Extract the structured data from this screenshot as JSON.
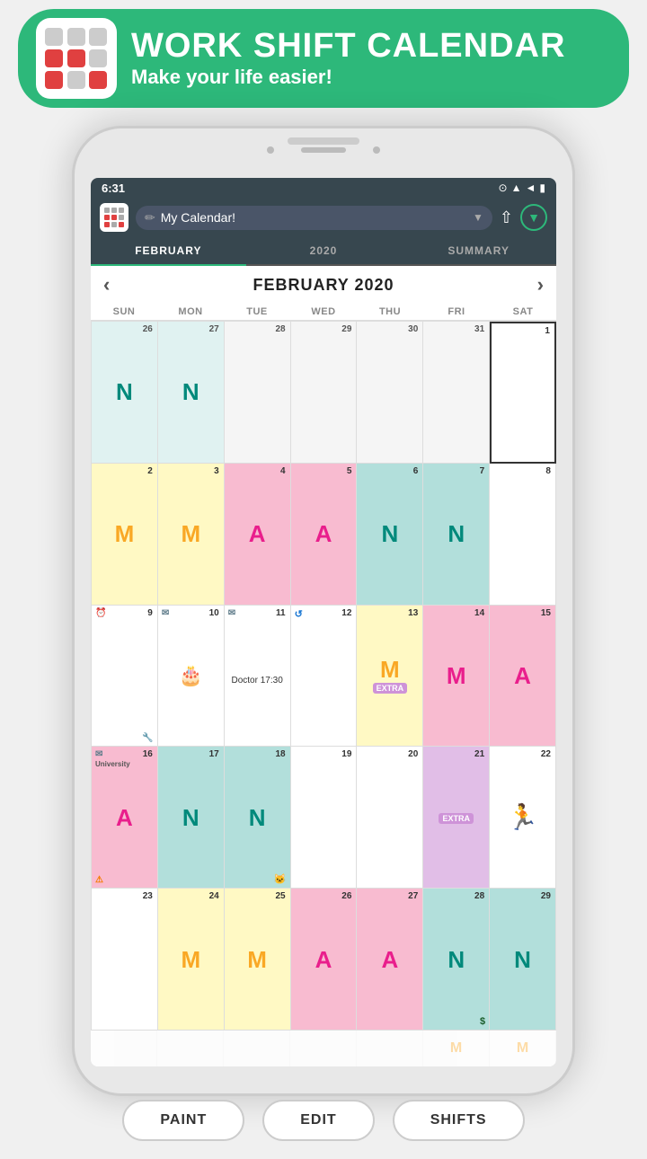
{
  "banner": {
    "title": "WORK SHIFT CALENDAR",
    "subtitle": "Make your life easier!"
  },
  "app": {
    "calendar_name": "My Calendar!",
    "tabs": [
      "FEBRUARY",
      "2020",
      "SUMMARY"
    ],
    "active_tab": 0
  },
  "calendar": {
    "month_title": "FEBRUARY 2020",
    "day_headers": [
      "SUN",
      "MON",
      "TUE",
      "WED",
      "THU",
      "FRI",
      "SAT"
    ],
    "nav_prev": "‹",
    "nav_next": "›"
  },
  "status_bar": {
    "time": "6:31",
    "icons": "▲◄■"
  },
  "bottom_buttons": {
    "paint": "PAINT",
    "edit": "EDIT",
    "shifts": "SHIFTS"
  },
  "cells": [
    {
      "day": "26",
      "shift": "N",
      "bg": "bg-light-teal",
      "letter_color": "letter-teal",
      "prev_month": true
    },
    {
      "day": "27",
      "shift": "N",
      "bg": "bg-light-teal",
      "letter_color": "letter-teal",
      "prev_month": true
    },
    {
      "day": "28",
      "shift": "",
      "bg": "bg-gray",
      "letter_color": "",
      "prev_month": true
    },
    {
      "day": "29",
      "shift": "",
      "bg": "bg-gray",
      "letter_color": "",
      "prev_month": true
    },
    {
      "day": "30",
      "shift": "",
      "bg": "bg-gray",
      "letter_color": "",
      "prev_month": true
    },
    {
      "day": "31",
      "shift": "",
      "bg": "bg-gray",
      "letter_color": "",
      "prev_month": true
    },
    {
      "day": "1",
      "shift": "",
      "bg": "bg-white",
      "letter_color": "",
      "selected": true
    },
    {
      "day": "2",
      "shift": "M",
      "bg": "bg-yellow",
      "letter_color": "letter-yellow"
    },
    {
      "day": "3",
      "shift": "M",
      "bg": "bg-yellow",
      "letter_color": "letter-yellow"
    },
    {
      "day": "4",
      "shift": "A",
      "bg": "bg-pink",
      "letter_color": "letter-pink"
    },
    {
      "day": "5",
      "shift": "A",
      "bg": "bg-pink",
      "letter_color": "letter-pink",
      "day_color": "pink"
    },
    {
      "day": "6",
      "shift": "N",
      "bg": "bg-teal",
      "letter_color": "letter-teal",
      "day_color": "teal"
    },
    {
      "day": "7",
      "shift": "N",
      "bg": "bg-teal",
      "letter_color": "letter-teal",
      "day_color": "teal"
    },
    {
      "day": "8",
      "shift": "",
      "bg": "bg-white",
      "letter_color": ""
    },
    {
      "day": "9",
      "shift": "",
      "bg": "bg-white",
      "letter_color": "",
      "has_alarm": true
    },
    {
      "day": "10",
      "shift": "",
      "bg": "bg-white",
      "letter_color": "",
      "event": "🎂",
      "has_mail": true
    },
    {
      "day": "11",
      "shift": "",
      "bg": "bg-white",
      "letter_color": "",
      "event_text": "Doctor\n17:30",
      "has_mail": true
    },
    {
      "day": "12",
      "shift": "",
      "bg": "bg-white",
      "letter_color": ""
    },
    {
      "day": "13",
      "shift": "M",
      "bg": "bg-yellow",
      "letter_color": "letter-yellow",
      "extra": true
    },
    {
      "day": "14",
      "shift": "M",
      "bg": "bg-pink",
      "letter_color": "letter-pink"
    },
    {
      "day": "15",
      "shift": "A",
      "bg": "bg-pink",
      "letter_color": "letter-pink",
      "day_color": "pink"
    },
    {
      "day": "16",
      "shift": "A",
      "bg": "bg-pink",
      "letter_color": "letter-pink",
      "day_color": "pink",
      "note": "University",
      "has_mail": true,
      "has_warning": true
    },
    {
      "day": "17",
      "shift": "N",
      "bg": "bg-teal",
      "letter_color": "letter-teal",
      "day_color": "teal"
    },
    {
      "day": "18",
      "shift": "N",
      "bg": "bg-teal",
      "letter_color": "letter-teal",
      "day_color": "teal"
    },
    {
      "day": "19",
      "shift": "",
      "bg": "bg-white",
      "letter_color": ""
    },
    {
      "day": "20",
      "shift": "",
      "bg": "bg-white",
      "letter_color": ""
    },
    {
      "day": "21",
      "shift": "",
      "bg": "bg-purple",
      "letter_color": "",
      "extra": true
    },
    {
      "day": "22",
      "shift": "🏃",
      "bg": "bg-white",
      "letter_color": "",
      "emoji": true
    },
    {
      "day": "23",
      "shift": "",
      "bg": "bg-white",
      "letter_color": ""
    },
    {
      "day": "24",
      "shift": "M",
      "bg": "bg-yellow",
      "letter_color": "letter-yellow"
    },
    {
      "day": "25",
      "shift": "M",
      "bg": "bg-yellow",
      "letter_color": "letter-yellow"
    },
    {
      "day": "26",
      "shift": "A",
      "bg": "bg-pink",
      "letter_color": "letter-pink",
      "day_color": "pink"
    },
    {
      "day": "27",
      "shift": "A",
      "bg": "bg-pink",
      "letter_color": "letter-pink",
      "day_color": "pink"
    },
    {
      "day": "28",
      "shift": "N",
      "bg": "bg-teal",
      "letter_color": "letter-teal",
      "day_color": "teal",
      "has_dollar": true
    },
    {
      "day": "29",
      "shift": "N",
      "bg": "bg-teal",
      "letter_color": "letter-teal",
      "day_color": "teal"
    }
  ],
  "ghost_cells": [
    {
      "shift": "",
      "color": ""
    },
    {
      "shift": "",
      "color": ""
    },
    {
      "shift": "",
      "color": ""
    },
    {
      "shift": "",
      "color": ""
    },
    {
      "shift": "",
      "color": ""
    },
    {
      "shift": "M",
      "color": "letter-yellow"
    },
    {
      "shift": "M",
      "color": "letter-yellow"
    }
  ]
}
